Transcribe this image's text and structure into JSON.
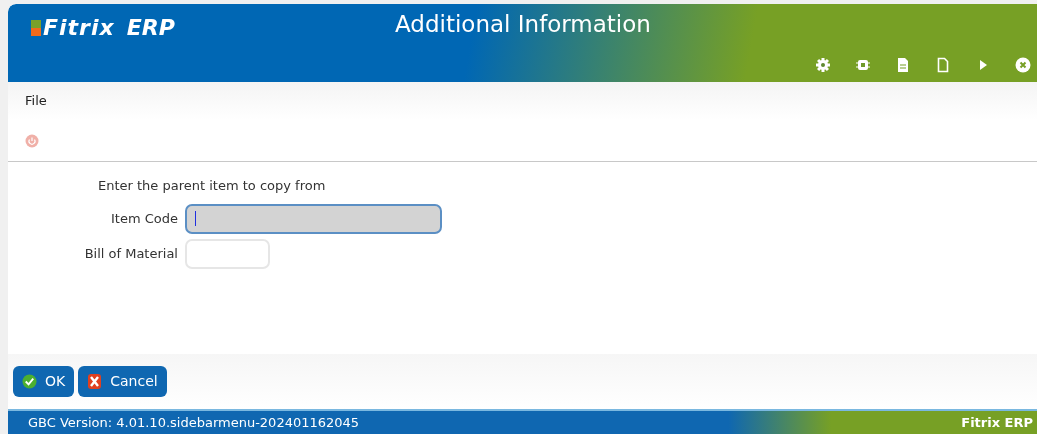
{
  "header": {
    "logo_name": "Fitrix",
    "logo_suffix": "ERP",
    "title": "Additional Information",
    "toolbar": [
      {
        "kind": "gear"
      },
      {
        "kind": "chip"
      },
      {
        "kind": "document"
      },
      {
        "kind": "blank-page"
      },
      {
        "kind": "play"
      },
      {
        "kind": "close"
      }
    ]
  },
  "menu": {
    "items": [
      "File"
    ]
  },
  "form": {
    "prompt": "Enter the parent item to copy from",
    "fields": [
      {
        "label": "Item Code",
        "focused": true,
        "wide": true
      },
      {
        "label": "Bill of Material",
        "focused": false,
        "wide": false
      }
    ]
  },
  "buttons": [
    {
      "kind": "ok",
      "label": "OK"
    },
    {
      "kind": "cancel",
      "label": "Cancel"
    }
  ],
  "status_bar": {
    "version": "GBC Version: 4.01.10.sidebarmenu-202401162045",
    "product": "Fitrix ERP"
  }
}
